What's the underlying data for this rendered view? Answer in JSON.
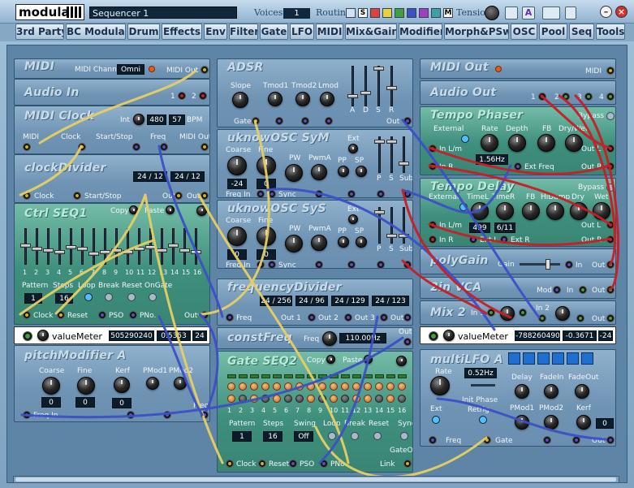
{
  "window": {
    "logo": "modular",
    "patch_name": "Sequencer 1",
    "voices_label": "Voices",
    "voices_value": "1",
    "routing_label": "Routing",
    "routing_s": "S",
    "routing_m": "M",
    "tension_label": "Tension",
    "colors": {
      "titlebar": "#a9c6de",
      "accent": "#1f6fd0"
    }
  },
  "tabs": [
    "3rd Party",
    "BC Modular",
    "Drum",
    "Effects",
    "Env",
    "Filter",
    "Gate",
    "LFO",
    "MIDI",
    "Mix&Gain",
    "Modifier",
    "Morph&PSw",
    "OSC",
    "Pool",
    "Seq",
    "Tools"
  ],
  "modules": {
    "midi": {
      "title": "MIDI",
      "channel_label": "MIDI Channel",
      "channel_value": "Omni",
      "out_label": "MIDI Out"
    },
    "audio_in": {
      "title": "Audio In",
      "p1": "1",
      "p2": "2"
    },
    "midi_clock": {
      "title": "MIDI Clock",
      "int_label": "Int",
      "div": "480",
      "bpm": "57",
      "bpm_label": "BPM",
      "midi_label": "MIDI",
      "clock_label": "Clock",
      "startstop_label": "Start/Stop",
      "freq_label": "Freq",
      "midiout_label": "MIDI Out"
    },
    "clock_divider": {
      "title": "clockDivider",
      "v1": "24 / 12",
      "v2": "24 / 12",
      "clock_label": "Clock",
      "startstop_label": "Start/Stop",
      "out1_label": "Out 1",
      "out2_label": "Out 2"
    },
    "ctrl_seq": {
      "title": "Ctrl SEQ1",
      "copy_label": "Copy",
      "paste_label": "Paste",
      "p_label": "P",
      "steps": [
        "1",
        "2",
        "3",
        "4",
        "5",
        "6",
        "7",
        "8",
        "9",
        "10",
        "11",
        "12",
        "13",
        "14",
        "15",
        "16"
      ],
      "pattern_label": "Pattern",
      "steps_label": "Steps",
      "loop_label": "Loop",
      "break_label": "Break",
      "reset_label": "Reset",
      "ongate_label": "OnGate",
      "pattern_value": "1",
      "steps_value": "16",
      "clock_label": "Clock",
      "reset2_label": "Reset",
      "pso_label": "PSO",
      "pno_label": "PNo.",
      "out_label": "Out"
    },
    "value_meter1": {
      "label": "valueMeter",
      "v1": "505290240",
      "v2": "0.5353",
      "v3": "24"
    },
    "pitch_mod": {
      "title": "pitchModifier A",
      "coarse_label": "Coarse",
      "fine_label": "Fine",
      "kerf_label": "Kerf",
      "pmod1_label": "PMod1",
      "pmod2_label": "PMod2",
      "coarse_value": "0",
      "fine_value": "0",
      "kerf_value": "0",
      "freqin_label": "Freq In",
      "freq_label": "Freq"
    },
    "adsr": {
      "title": "ADSR",
      "slope_label": "Slope",
      "tmod1_label": "Tmod1",
      "tmod2_label": "Tmod2",
      "lmod_label": "Lmod",
      "a": "A",
      "d": "D",
      "s": "S",
      "r": "R",
      "gate_label": "Gate",
      "out_label": "Out"
    },
    "osc1": {
      "title": "uknowOSC SyM",
      "coarse_label": "Coarse",
      "fine_label": "Fine",
      "pw_label": "PW",
      "pwma_label": "PwmA",
      "ext_label": "Ext",
      "pp_label": "PP",
      "sp_label": "SP",
      "p_label": "P",
      "s_label": "S",
      "sub_label": "Sub",
      "coarse_value": "-24",
      "fine_value": "0",
      "freqin_label": "Freq In",
      "sync_label": "Sync"
    },
    "osc2": {
      "title": "uknowOSC SyS",
      "coarse_label": "Coarse",
      "fine_label": "Fine",
      "pw_label": "PW",
      "pwma_label": "PwmA",
      "ext_label": "Ext",
      "pp_label": "PP",
      "sp_label": "SP",
      "p_label": "P",
      "s_label": "S",
      "sub_label": "Sub",
      "coarse_value": "0",
      "fine_value": "0",
      "freqin_label": "Freq In",
      "sync_label": "Sync"
    },
    "freq_div": {
      "title": "frequencyDivider",
      "v1": "24 / 256",
      "v2": "24 / 96",
      "v3": "24 / 129",
      "v4": "24 / 123",
      "freq_label": "Freq",
      "out1_label": "Out 1",
      "out2_label": "Out 2",
      "out3_label": "Out 3",
      "out4_label": "Out 4"
    },
    "const_freq": {
      "title": "constFreq",
      "freq_label": "Freq",
      "freq_value": "110.00Hz",
      "out_label": "Out"
    },
    "gate_seq": {
      "title": "Gate SEQ2",
      "copy_label": "Copy",
      "paste_label": "Paste",
      "p_label": "P",
      "steps": [
        "1",
        "2",
        "3",
        "4",
        "5",
        "6",
        "7",
        "8",
        "9",
        "10",
        "11",
        "12",
        "13",
        "14",
        "15",
        "16"
      ],
      "pattern_label": "Pattern",
      "steps_label": "Steps",
      "swing_label": "Swing",
      "loop_label": "Loop",
      "break_label": "Break",
      "reset_label": "Reset",
      "sync_label": "Sync",
      "pattern_value": "1",
      "steps_value": "16",
      "swing_value": "Off",
      "gateout_label": "GateOut",
      "clock_label": "Clock",
      "reset2_label": "Reset",
      "pso_label": "PSO",
      "pno_label": "PNo.",
      "link_label": "Link"
    },
    "midi_out": {
      "title": "MIDI Out",
      "midi_label": "MIDI"
    },
    "audio_out": {
      "title": "Audio Out",
      "p1": "1",
      "p2": "2",
      "p3": "3",
      "p4": "4"
    },
    "tempo_phaser": {
      "title": "Tempo Phaser",
      "bypass_label": "Bypass",
      "external_label": "External",
      "rate_label": "Rate",
      "depth_label": "Depth",
      "fb_label": "FB",
      "drywet_label": "Dry/Wet",
      "rate_value": "1.56Hz",
      "inl_label": "In L/m",
      "inr_label": "In R",
      "extfreq_label": "Ext Freq",
      "outl_label": "Out L",
      "outr_label": "Out R"
    },
    "tempo_delay": {
      "title": "Tempo Delay",
      "bypass_label": "Bypass",
      "external_label": "External",
      "timel_label": "TimeL",
      "timer_label": "TimeR",
      "fb_label": "FB",
      "hidamp_label": "HiDamp",
      "dry_label": "Dry",
      "wet_label": "Wet",
      "timel_value": "499",
      "timer_value": "6/11",
      "inl_label": "In L/m",
      "inr_label": "In R",
      "extl_label": "Ext L",
      "extr_label": "Ext R",
      "outl_label": "Out L",
      "outr_label": "Out R"
    },
    "poly_gain": {
      "title": "polyGain",
      "gain_label": "Gain",
      "in_label": "In",
      "out_label": "Out"
    },
    "vca": {
      "title": "2in VCA",
      "mod_label": "Mod",
      "in_label": "In",
      "out_label": "Out"
    },
    "mix2": {
      "title": "Mix 2",
      "in1_label": "In 1",
      "in2_label": "In 2",
      "out_label": "Out"
    },
    "value_meter2": {
      "label": "valueMeter",
      "v1": "-788260490",
      "v2": "-0.3671",
      "v3": "-24"
    },
    "multi_lfo": {
      "title": "multiLFO A",
      "rate_label": "Rate",
      "rate_value": "0.52Hz",
      "init_phase_label": "Init Phase",
      "retrig_label": "Retrig",
      "delay_label": "Delay",
      "fadein_label": "FadeIn",
      "fadeout_label": "FadeOut",
      "pmod1_label": "PMod1",
      "pmod2_label": "PMod2",
      "kerf_label": "Kerf",
      "kerf_value": "0",
      "ext_label": "Ext",
      "freq_label": "Freq",
      "gate_label": "Gate",
      "out_label": "Out"
    }
  },
  "cable_colors": {
    "yellow": "#e8cf62",
    "blue": "#3c50c8",
    "red": "#c81e24"
  }
}
